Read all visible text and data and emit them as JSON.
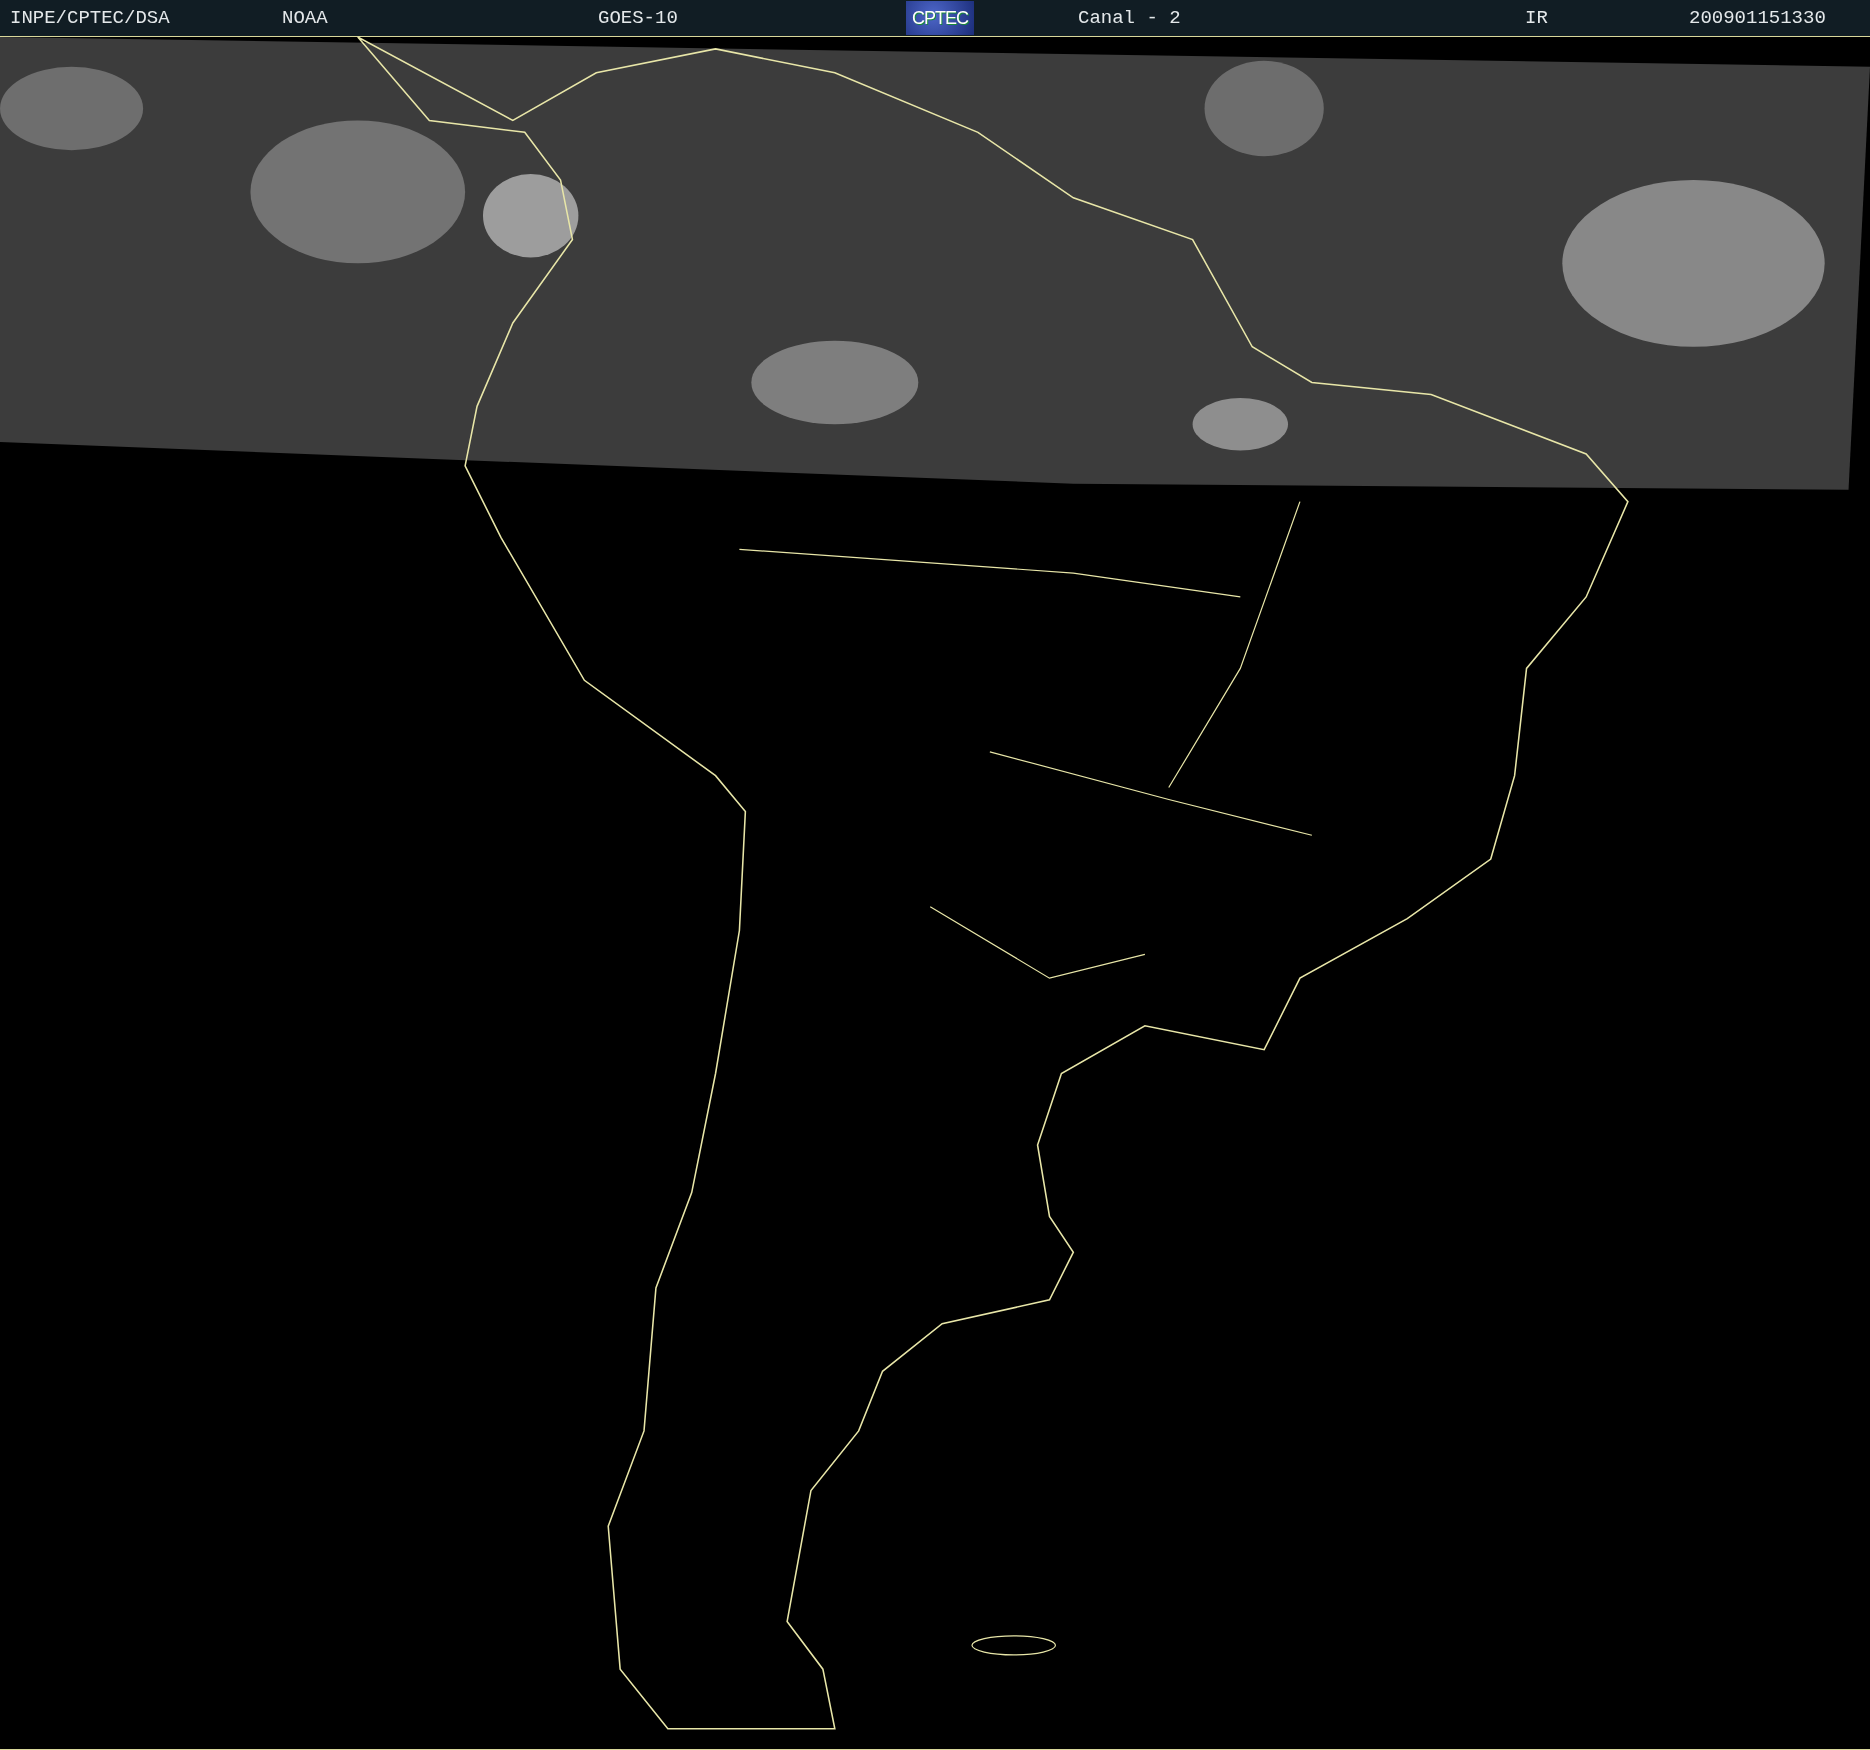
{
  "header": {
    "institution": "INPE/CPTEC/DSA",
    "agency": "NOAA",
    "satellite": "GOES-10",
    "logo": "CPTEC",
    "channel": "Canal - 2",
    "band": "IR",
    "timestamp": "200901151330"
  }
}
